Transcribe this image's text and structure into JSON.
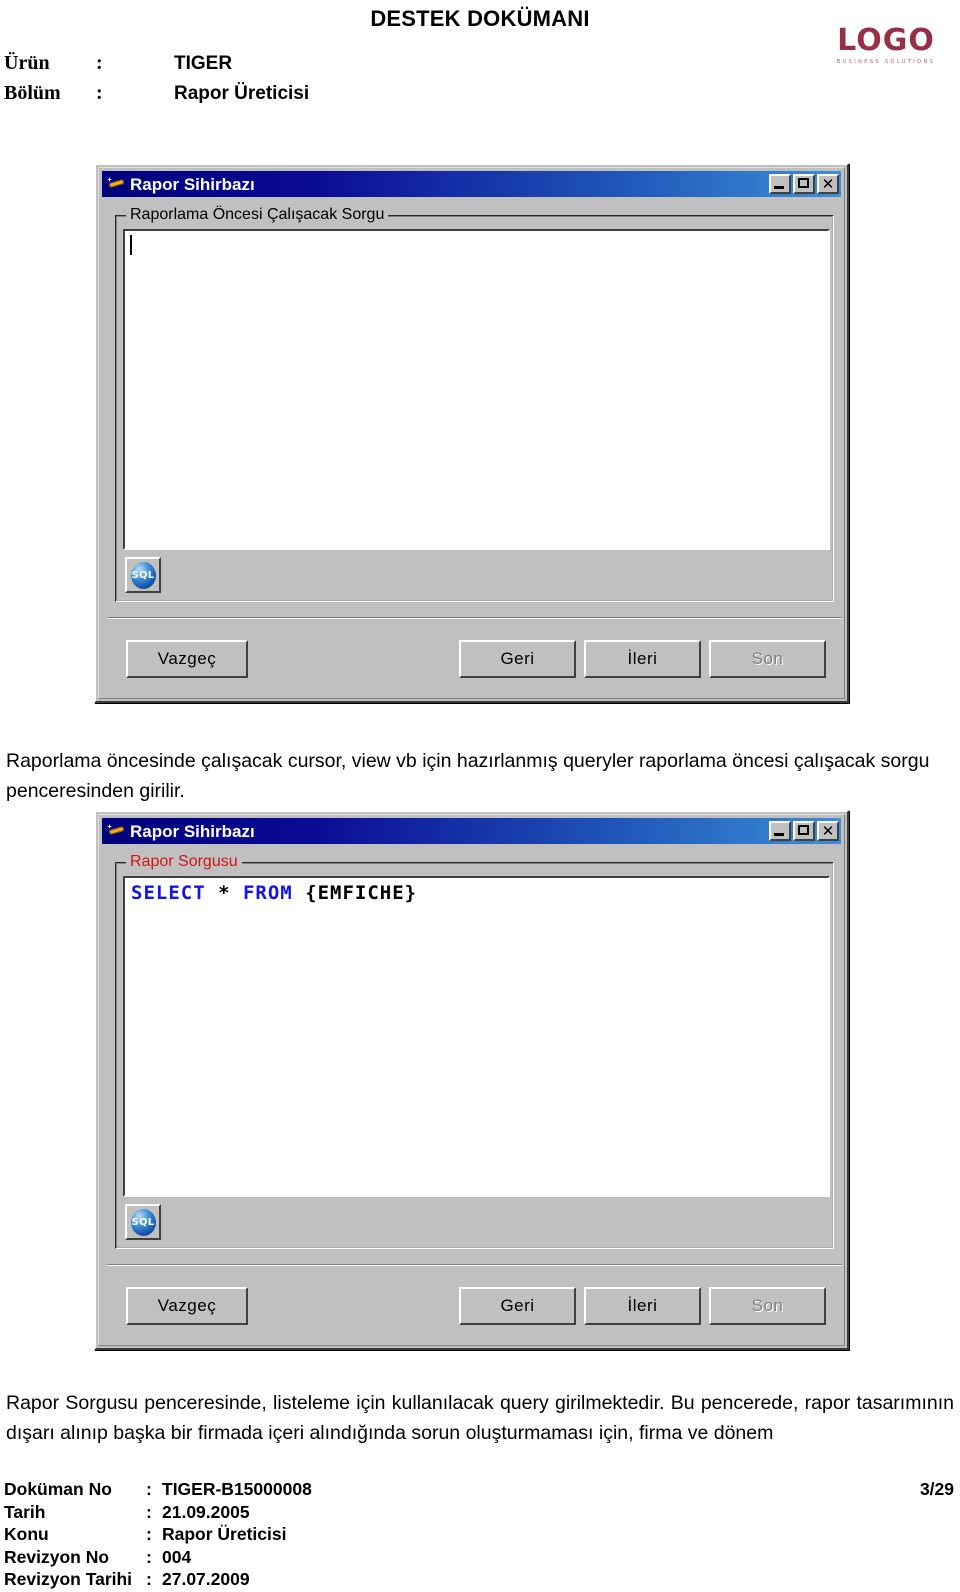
{
  "header": {
    "title": "DESTEK DOKÜMANI",
    "fields": [
      {
        "label": "Ürün",
        "colon": ":",
        "value": "TIGER"
      },
      {
        "label": "Bölüm",
        "colon": ":",
        "value": "Rapor Üreticisi"
      }
    ],
    "logo": {
      "word": "LOGO",
      "tagline": "BUSINESS SOLUTIONS",
      "color": "#8e1f38"
    }
  },
  "dialog1": {
    "title": "Rapor Sihirbazı",
    "icon": "wand-icon",
    "window_buttons": {
      "minimize": "_",
      "maximize": "□",
      "close": "X"
    },
    "group_label": "Raporlama Öncesi Çalışacak Sorgu",
    "group_label_color": "#000000",
    "query_text": "",
    "sql_button_label": "SQL",
    "buttons": [
      {
        "label": "Vazgeç",
        "disabled": false
      },
      {
        "label": "Geri",
        "disabled": false
      },
      {
        "label": "İleri",
        "disabled": false
      },
      {
        "label": "Son",
        "disabled": true
      }
    ]
  },
  "paragraph1": "Raporlama öncesinde çalışacak cursor, view vb için hazırlanmış queryler raporlama öncesi çalışacak sorgu penceresinden girilir.",
  "dialog2": {
    "title": "Rapor Sihirbazı",
    "icon": "wand-icon",
    "window_buttons": {
      "minimize": "_",
      "maximize": "□",
      "close": "X"
    },
    "group_label": "Rapor Sorgusu",
    "group_label_color": "#d41414",
    "query_tokens": [
      {
        "text": "SELECT",
        "type": "keyword"
      },
      {
        "text": " * ",
        "type": "plain"
      },
      {
        "text": "FROM",
        "type": "keyword"
      },
      {
        "text": " {EMFICHE}",
        "type": "plain"
      }
    ],
    "query_text": "SELECT * FROM {EMFICHE}",
    "sql_button_label": "SQL",
    "buttons": [
      {
        "label": "Vazgeç",
        "disabled": false
      },
      {
        "label": "Geri",
        "disabled": false
      },
      {
        "label": "İleri",
        "disabled": false
      },
      {
        "label": "Son",
        "disabled": true
      }
    ]
  },
  "paragraph2": "Rapor Sorgusu penceresinde, listeleme için kullanılacak query girilmektedir. Bu pencerede, rapor tasarımının dışarı alınıp başka bir firmada içeri alındığında sorun oluşturmaması için, firma ve dönem",
  "footer": {
    "rows": [
      {
        "label": "Doküman No",
        "colon": ":",
        "value": "TIGER-B15000008"
      },
      {
        "label": "Tarih",
        "colon": ":",
        "value": "21.09.2005"
      },
      {
        "label": "Konu",
        "colon": ":",
        "value": "Rapor Üreticisi"
      },
      {
        "label": "Revizyon No",
        "colon": ":",
        "value": "004"
      },
      {
        "label": "Revizyon Tarihi",
        "colon": ":",
        "value": "27.07.2009"
      }
    ],
    "page": "3/29"
  }
}
